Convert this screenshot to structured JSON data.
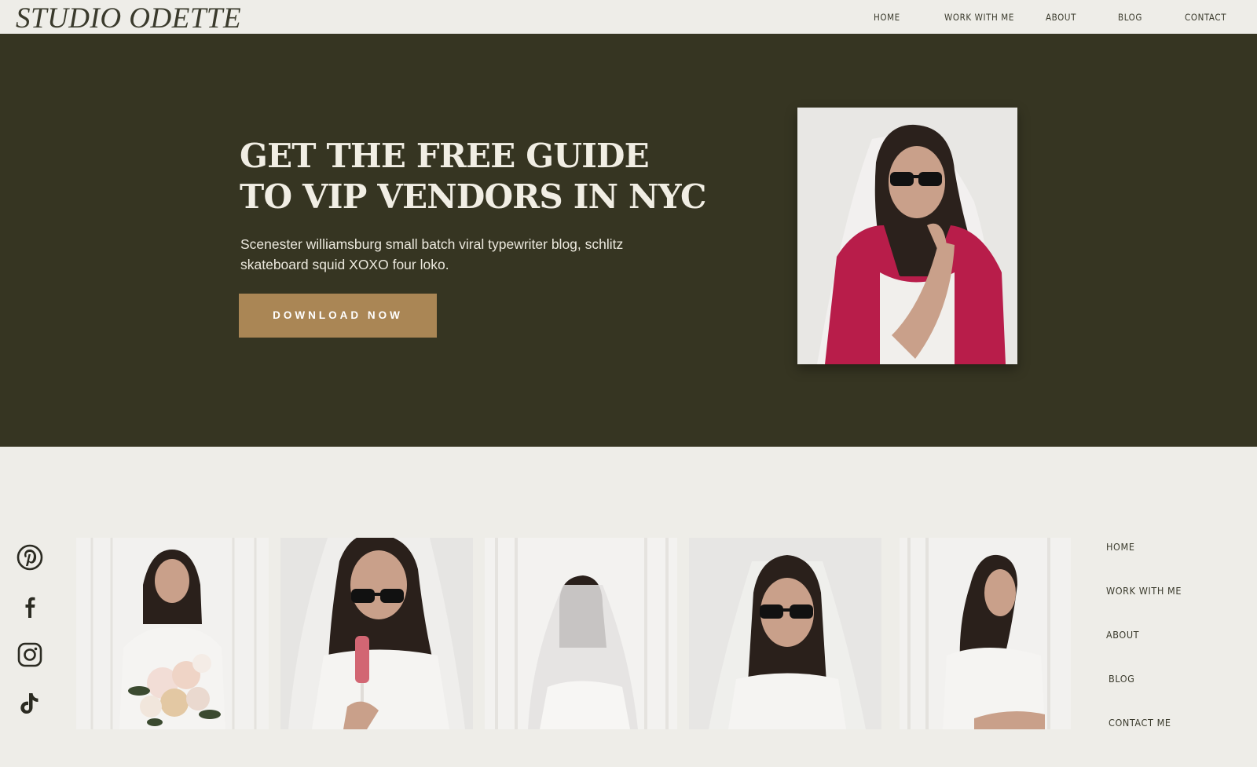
{
  "brand": {
    "logo": "STUDIO ODETTE"
  },
  "topnav": {
    "items": [
      "HOME",
      "WORK WITH ME",
      "ABOUT",
      "BLOG",
      "CONTACT"
    ]
  },
  "hero": {
    "title_line1": "GET THE FREE GUIDE",
    "title_line2": "TO VIP VENDORS IN NYC",
    "text": "Scenester williamsburg small batch viral typewriter blog, schlitz skateboard squid XOXO four loko.",
    "button": "DOWNLOAD NOW"
  },
  "social": [
    "pinterest-icon",
    "facebook-icon",
    "instagram-icon",
    "tiktok-icon"
  ],
  "footnav": {
    "items": [
      "HOME",
      "WORK WITH ME",
      "ABOUT",
      "BLOG",
      "CONTACT ME"
    ]
  },
  "colors": {
    "hero_bg": "#363522",
    "page_bg": "#eeede8",
    "accent": "#aa8655",
    "dress_red": "#b81d4a"
  }
}
